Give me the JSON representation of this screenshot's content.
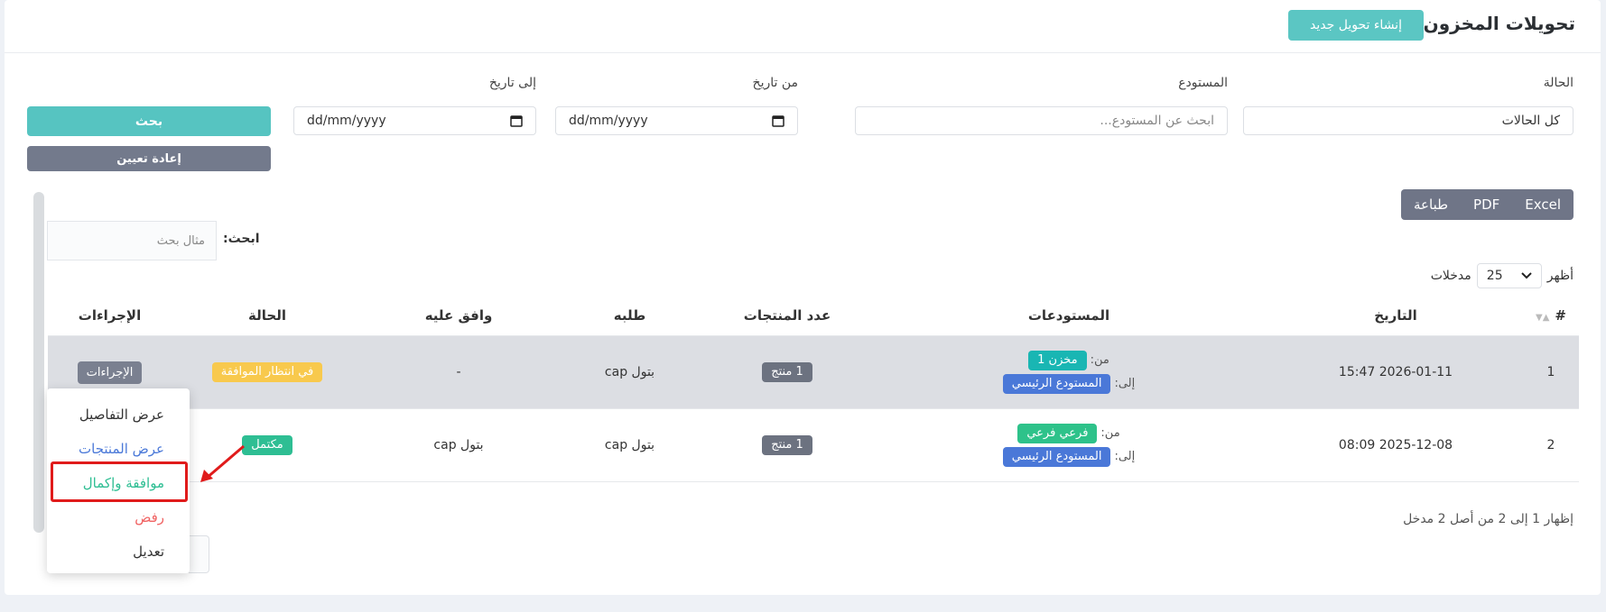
{
  "header": {
    "title": "تحويلات المخزون",
    "new_button": "إنشاء تحويل جديد"
  },
  "filters": {
    "status": {
      "label": "الحالة",
      "value": "كل الحالات"
    },
    "warehouse": {
      "label": "المستودع",
      "placeholder": "ابحث عن المستودع..."
    },
    "from_date": {
      "label": "من تاريخ",
      "placeholder": "dd/mm/yyyy"
    },
    "to_date": {
      "label": "إلى تاريخ",
      "placeholder": "dd/mm/yyyy"
    },
    "search_button": "بحث",
    "reset_button": "إعادة تعيين"
  },
  "export": {
    "excel": "Excel",
    "pdf": "PDF",
    "print": "طباعة"
  },
  "table_search": {
    "label": "ابحث:",
    "placeholder": "مثال بحث"
  },
  "entries": {
    "show": "أظهر",
    "value": "25",
    "suffix": "مدخلات"
  },
  "table": {
    "columns": [
      "#",
      "التاريخ",
      "المستودعات",
      "عدد المنتجات",
      "طلبه",
      "وافق عليه",
      "الحالة",
      "الإجراءات"
    ],
    "from_label": "من:",
    "to_label": "إلى:",
    "rows": [
      {
        "num": "1",
        "date": "2026-01-11 15:47",
        "from": "مخزن 1",
        "to": "المستودع الرئيسي",
        "count": "1 منتج",
        "requested_by": "بتول cap",
        "approved_by": "-",
        "status": "في انتظار الموافقة",
        "action": "الإجراءات"
      },
      {
        "num": "2",
        "date": "2025-12-08 08:09",
        "from": "فرعي فرعي",
        "to": "المستودع الرئيسي",
        "count": "1 منتج",
        "requested_by": "بتول cap",
        "approved_by": "بتول cap",
        "status": "مكتمل",
        "action": ""
      }
    ]
  },
  "dropdown": {
    "view_details": "عرض التفاصيل",
    "view_products": "عرض المنتجات",
    "approve_complete": "موافقة وإكمال",
    "reject": "رفض",
    "edit": "تعديل"
  },
  "footer": {
    "info": "إظهار 1 إلى 2 من أصل 2 مدخل"
  },
  "colors": {
    "accent": "#56c4c1",
    "highlight": "#e01b1b",
    "row_highlight": "#dcdee3"
  }
}
